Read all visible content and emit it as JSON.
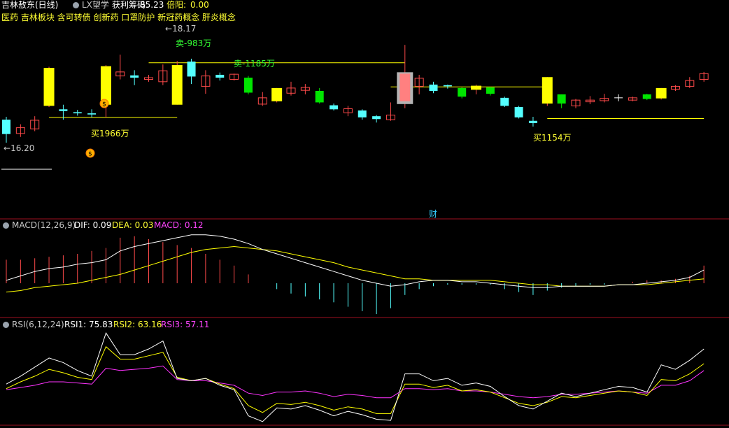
{
  "header": {
    "stock_name": "吉林敖东(日线)",
    "indicator_name": "LX望学",
    "chip_label": "获利筹码:",
    "chip_value": "85.23",
    "ratio_label": "倍阳:",
    "ratio_value": "0.00",
    "concepts": "医药 吉林板块 含可转债 创新药 口罩防护 新冠药概念 肝炎概念"
  },
  "price_panel": {
    "high_label": "18.17",
    "low_label": "16.20",
    "cai_label": "财",
    "sell_labels": [
      "卖-983万",
      "卖-1185万"
    ],
    "buy_labels": [
      "买1966万",
      "买1154万"
    ]
  },
  "macd_panel": {
    "title": "MACD(12,26,9)",
    "dif_label": "DIF: 0.09",
    "dea_label": "DEA: 0.03",
    "macd_label": "MACD: 0.12"
  },
  "rsi_panel": {
    "title": "RSI(6,12,24)",
    "rsi1_label": "RSI1: 75.83",
    "rsi2_label": "RSI2: 63.16",
    "rsi3_label": "RSI3: 57.11"
  },
  "colors": {
    "up": "#ff4a4a",
    "down_cyan": "#54ffff",
    "down_green": "#00e500",
    "yellow": "#ffff00",
    "magenta": "#ff33ff",
    "white": "#ffffff",
    "divider": "#a01020"
  },
  "chart_data": [
    {
      "type": "candlestick",
      "y_high": 18.17,
      "y_low": 16.2,
      "candles": [
        {
          "o": 16.6,
          "c": 16.35,
          "h": 16.65,
          "l": 16.2,
          "style": "down_cyan"
        },
        {
          "o": 16.36,
          "c": 16.46,
          "h": 16.52,
          "l": 16.3,
          "style": "up"
        },
        {
          "o": 16.44,
          "c": 16.59,
          "h": 16.66,
          "l": 16.4,
          "style": "up"
        },
        {
          "o": 16.84,
          "c": 17.5,
          "h": 17.52,
          "l": 16.82,
          "style": "yellow"
        },
        {
          "o": 16.78,
          "c": 16.75,
          "h": 16.86,
          "l": 16.6,
          "style": "down_cyan"
        },
        {
          "o": 16.73,
          "c": 16.71,
          "h": 16.77,
          "l": 16.67,
          "style": "down_cyan"
        },
        {
          "o": 16.71,
          "c": 16.69,
          "h": 16.78,
          "l": 16.64,
          "style": "down_cyan"
        },
        {
          "o": 16.86,
          "c": 17.53,
          "h": 17.55,
          "l": 16.64,
          "style": "yellow"
        },
        {
          "o": 17.36,
          "c": 17.43,
          "h": 17.73,
          "l": 17.3,
          "style": "up"
        },
        {
          "o": 17.37,
          "c": 17.33,
          "h": 17.46,
          "l": 17.2,
          "style": "down_cyan"
        },
        {
          "o": 17.3,
          "c": 17.33,
          "h": 17.38,
          "l": 17.26,
          "style": "up"
        },
        {
          "o": 17.26,
          "c": 17.45,
          "h": 17.56,
          "l": 17.2,
          "style": "up"
        },
        {
          "o": 16.86,
          "c": 17.55,
          "h": 17.62,
          "l": 16.86,
          "style": "yellow"
        },
        {
          "o": 17.61,
          "c": 17.35,
          "h": 17.66,
          "l": 17.22,
          "style": "down_cyan"
        },
        {
          "o": 17.18,
          "c": 17.36,
          "h": 17.46,
          "l": 17.05,
          "style": "up"
        },
        {
          "o": 17.38,
          "c": 17.33,
          "h": 17.42,
          "l": 17.28,
          "style": "down_cyan"
        },
        {
          "o": 17.3,
          "c": 17.39,
          "h": 17.4,
          "l": 17.28,
          "style": "up"
        },
        {
          "o": 17.33,
          "c": 17.07,
          "h": 17.36,
          "l": 17.04,
          "style": "down_green"
        },
        {
          "o": 16.87,
          "c": 16.98,
          "h": 17.08,
          "l": 16.84,
          "style": "up"
        },
        {
          "o": 16.92,
          "c": 17.15,
          "h": 17.15,
          "l": 16.9,
          "style": "yellow"
        },
        {
          "o": 17.06,
          "c": 17.15,
          "h": 17.26,
          "l": 17.02,
          "style": "up"
        },
        {
          "o": 17.11,
          "c": 17.16,
          "h": 17.22,
          "l": 17.04,
          "style": "up"
        },
        {
          "o": 17.1,
          "c": 16.9,
          "h": 17.15,
          "l": 16.88,
          "style": "down_green"
        },
        {
          "o": 16.85,
          "c": 16.78,
          "h": 16.88,
          "l": 16.76,
          "style": "down_cyan"
        },
        {
          "o": 16.72,
          "c": 16.79,
          "h": 16.84,
          "l": 16.66,
          "style": "up"
        },
        {
          "o": 16.76,
          "c": 16.64,
          "h": 16.78,
          "l": 16.6,
          "style": "down_cyan"
        },
        {
          "o": 16.66,
          "c": 16.61,
          "h": 16.68,
          "l": 16.55,
          "style": "down_cyan"
        },
        {
          "o": 16.6,
          "c": 16.68,
          "h": 16.9,
          "l": 16.58,
          "style": "up"
        },
        {
          "o": 16.92,
          "c": 17.4,
          "h": 17.9,
          "l": 16.8,
          "style": "pink"
        },
        {
          "o": 17.18,
          "c": 17.32,
          "h": 17.38,
          "l": 17.04,
          "style": "up"
        },
        {
          "o": 17.21,
          "c": 17.1,
          "h": 17.26,
          "l": 17.06,
          "style": "down_cyan"
        },
        {
          "o": 17.2,
          "c": 17.18,
          "h": 17.21,
          "l": 17.14,
          "style": "down_cyan"
        },
        {
          "o": 17.15,
          "c": 17.0,
          "h": 17.16,
          "l": 16.97,
          "style": "down_green"
        },
        {
          "o": 17.12,
          "c": 17.19,
          "h": 17.21,
          "l": 17.04,
          "style": "yellow"
        },
        {
          "o": 17.16,
          "c": 17.05,
          "h": 17.17,
          "l": 17.02,
          "style": "down_green"
        },
        {
          "o": 16.98,
          "c": 16.84,
          "h": 17.0,
          "l": 16.82,
          "style": "down_cyan"
        },
        {
          "o": 16.82,
          "c": 16.64,
          "h": 16.84,
          "l": 16.62,
          "style": "down_cyan"
        },
        {
          "o": 16.58,
          "c": 16.54,
          "h": 16.65,
          "l": 16.48,
          "style": "down_cyan"
        },
        {
          "o": 16.88,
          "c": 17.34,
          "h": 17.34,
          "l": 16.84,
          "style": "yellow"
        },
        {
          "o": 16.88,
          "c": 17.04,
          "h": 17.04,
          "l": 16.8,
          "style": "down_green"
        },
        {
          "o": 16.94,
          "c": 16.84,
          "h": 16.96,
          "l": 16.8,
          "style": "up"
        },
        {
          "o": 16.91,
          "c": 16.94,
          "h": 17.01,
          "l": 16.87,
          "style": "up"
        },
        {
          "o": 16.93,
          "c": 16.97,
          "h": 17.05,
          "l": 16.9,
          "style": "up"
        },
        {
          "o": 16.98,
          "c": 16.98,
          "h": 17.04,
          "l": 16.92,
          "style": "doji"
        },
        {
          "o": 16.94,
          "c": 16.98,
          "h": 17.0,
          "l": 16.92,
          "style": "up"
        },
        {
          "o": 17.04,
          "c": 16.96,
          "h": 17.05,
          "l": 16.94,
          "style": "down_green"
        },
        {
          "o": 16.97,
          "c": 17.15,
          "h": 17.15,
          "l": 16.95,
          "style": "yellow"
        },
        {
          "o": 17.13,
          "c": 17.18,
          "h": 17.2,
          "l": 17.1,
          "style": "up"
        },
        {
          "o": 17.18,
          "c": 17.28,
          "h": 17.34,
          "l": 17.15,
          "style": "up"
        },
        {
          "o": 17.3,
          "c": 17.4,
          "h": 17.43,
          "l": 17.26,
          "style": "up"
        }
      ],
      "ref_lines": [
        {
          "y": 17.59,
          "from": 10,
          "to": 28
        },
        {
          "y": 17.17,
          "from": 27,
          "to": 38
        },
        {
          "y": 16.64,
          "from": 3,
          "to": 12
        },
        {
          "y": 16.62,
          "from": 38,
          "to": 49
        }
      ]
    },
    {
      "type": "line",
      "title": "MACD(12,26,9)",
      "y_range": [
        -0.25,
        0.36
      ],
      "series": [
        {
          "name": "DIF",
          "values": [
            0.02,
            0.05,
            0.08,
            0.1,
            0.11,
            0.13,
            0.14,
            0.16,
            0.22,
            0.25,
            0.27,
            0.29,
            0.31,
            0.33,
            0.33,
            0.32,
            0.3,
            0.27,
            0.23,
            0.2,
            0.17,
            0.14,
            0.11,
            0.08,
            0.05,
            0.02,
            0.0,
            -0.02,
            -0.01,
            0.01,
            0.02,
            0.02,
            0.01,
            0.01,
            0.0,
            -0.01,
            -0.02,
            -0.03,
            -0.03,
            -0.02,
            -0.02,
            -0.02,
            -0.02,
            -0.01,
            -0.01,
            0.0,
            0.01,
            0.02,
            0.04,
            0.09
          ]
        },
        {
          "name": "DEA",
          "values": [
            -0.06,
            -0.05,
            -0.03,
            -0.02,
            -0.01,
            0.0,
            0.02,
            0.04,
            0.06,
            0.09,
            0.12,
            0.15,
            0.18,
            0.21,
            0.23,
            0.24,
            0.25,
            0.24,
            0.23,
            0.22,
            0.2,
            0.18,
            0.16,
            0.14,
            0.11,
            0.09,
            0.07,
            0.05,
            0.03,
            0.03,
            0.02,
            0.02,
            0.02,
            0.02,
            0.02,
            0.01,
            0.0,
            -0.01,
            -0.01,
            -0.02,
            -0.02,
            -0.02,
            -0.02,
            -0.01,
            -0.01,
            -0.01,
            0.0,
            0.01,
            0.02,
            0.03
          ]
        },
        {
          "name": "MACD",
          "values": [
            0.16,
            0.16,
            0.17,
            0.18,
            0.19,
            0.2,
            0.22,
            0.24,
            0.31,
            0.32,
            0.3,
            0.28,
            0.26,
            0.24,
            0.2,
            0.16,
            0.12,
            0.06,
            0.0,
            -0.04,
            -0.07,
            -0.09,
            -0.11,
            -0.13,
            -0.16,
            -0.19,
            -0.21,
            -0.17,
            -0.08,
            -0.04,
            -0.02,
            -0.01,
            -0.01,
            -0.01,
            -0.01,
            -0.04,
            -0.06,
            -0.08,
            -0.05,
            -0.03,
            -0.02,
            -0.01,
            -0.01,
            0.0,
            0.01,
            0.02,
            0.02,
            0.03,
            0.05,
            0.12
          ]
        }
      ]
    },
    {
      "type": "line",
      "title": "RSI(6,12,24)",
      "y_range": [
        10,
        92
      ],
      "series": [
        {
          "name": "RSI1",
          "values": [
            45,
            52,
            60,
            68,
            64,
            57,
            52,
            90,
            71,
            71,
            76,
            83,
            50,
            48,
            50,
            44,
            40,
            17,
            12,
            24,
            23,
            26,
            22,
            17,
            21,
            18,
            14,
            13,
            54,
            54,
            48,
            50,
            44,
            46,
            43,
            34,
            26,
            23,
            30,
            37,
            34,
            37,
            40,
            43,
            42,
            38,
            62,
            58,
            66,
            76
          ]
        },
        {
          "name": "RSI2",
          "values": [
            41,
            47,
            52,
            58,
            55,
            51,
            49,
            78,
            67,
            67,
            70,
            73,
            51,
            48,
            50,
            45,
            41,
            26,
            20,
            28,
            27,
            29,
            26,
            22,
            25,
            23,
            19,
            19,
            45,
            45,
            42,
            44,
            39,
            40,
            38,
            33,
            28,
            26,
            29,
            34,
            33,
            35,
            37,
            39,
            38,
            35,
            49,
            48,
            54,
            63
          ]
        },
        {
          "name": "RSI3",
          "values": [
            40,
            42,
            44,
            47,
            47,
            46,
            45,
            59,
            57,
            58,
            59,
            61,
            49,
            48,
            48,
            46,
            44,
            37,
            35,
            38,
            38,
            39,
            37,
            34,
            36,
            35,
            33,
            33,
            41,
            41,
            40,
            41,
            39,
            39,
            38,
            36,
            34,
            33,
            34,
            36,
            36,
            37,
            38,
            39,
            38,
            37,
            44,
            44,
            48,
            57
          ]
        }
      ]
    }
  ]
}
